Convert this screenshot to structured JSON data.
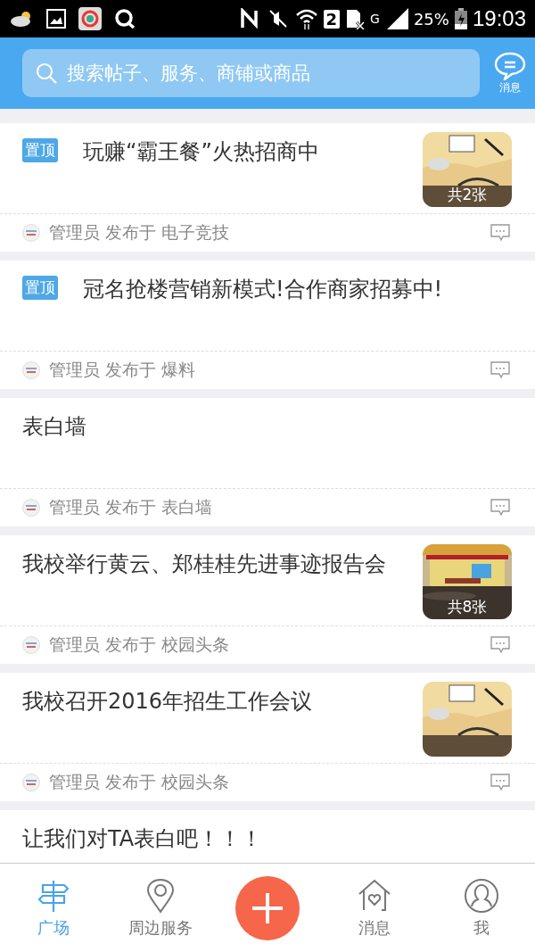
{
  "status_bar": {
    "sim_number": "2",
    "network": "G",
    "battery_text": "25%",
    "time": "19:03"
  },
  "header": {
    "search": {
      "placeholder": "搜索帖子、服务、商铺或商品"
    },
    "message_label": "消息"
  },
  "posts": [
    {
      "pinned": true,
      "pin_label": "置顶",
      "title": "玩赚“霸王餐”火热招商中",
      "thumbnail": {
        "kind": "picture",
        "count": "共2张"
      },
      "meta": "管理员 发布于 电子竞技"
    },
    {
      "pinned": true,
      "pin_label": "置顶",
      "title": "冠名抢楼营销新模式!合作商家招募中!",
      "meta": "管理员 发布于 爆料"
    },
    {
      "pinned": false,
      "title": "表白墙",
      "meta": "管理员 发布于 表白墙"
    },
    {
      "pinned": false,
      "title": "我校举行黄云、郑桂桂先进事迹报告会",
      "thumbnail": {
        "kind": "picture",
        "count": "共8张"
      },
      "meta": "管理员 发布于 校园头条"
    },
    {
      "pinned": false,
      "title": "我校召开2016年招生工作会议",
      "meta": "管理员 发布于 校园头条"
    },
    {
      "pinned": false,
      "title": "让我们对TA表白吧！！！"
    }
  ],
  "bottom_nav": [
    {
      "kind": "signpost",
      "label": "广场",
      "selected": true
    },
    {
      "kind": "pin",
      "label": "周边服务",
      "selected": false
    },
    {
      "kind": "fab",
      "selected": false
    },
    {
      "kind": "house",
      "label": "消息",
      "selected": false
    },
    {
      "kind": "person",
      "label": "我",
      "selected": false
    }
  ]
}
